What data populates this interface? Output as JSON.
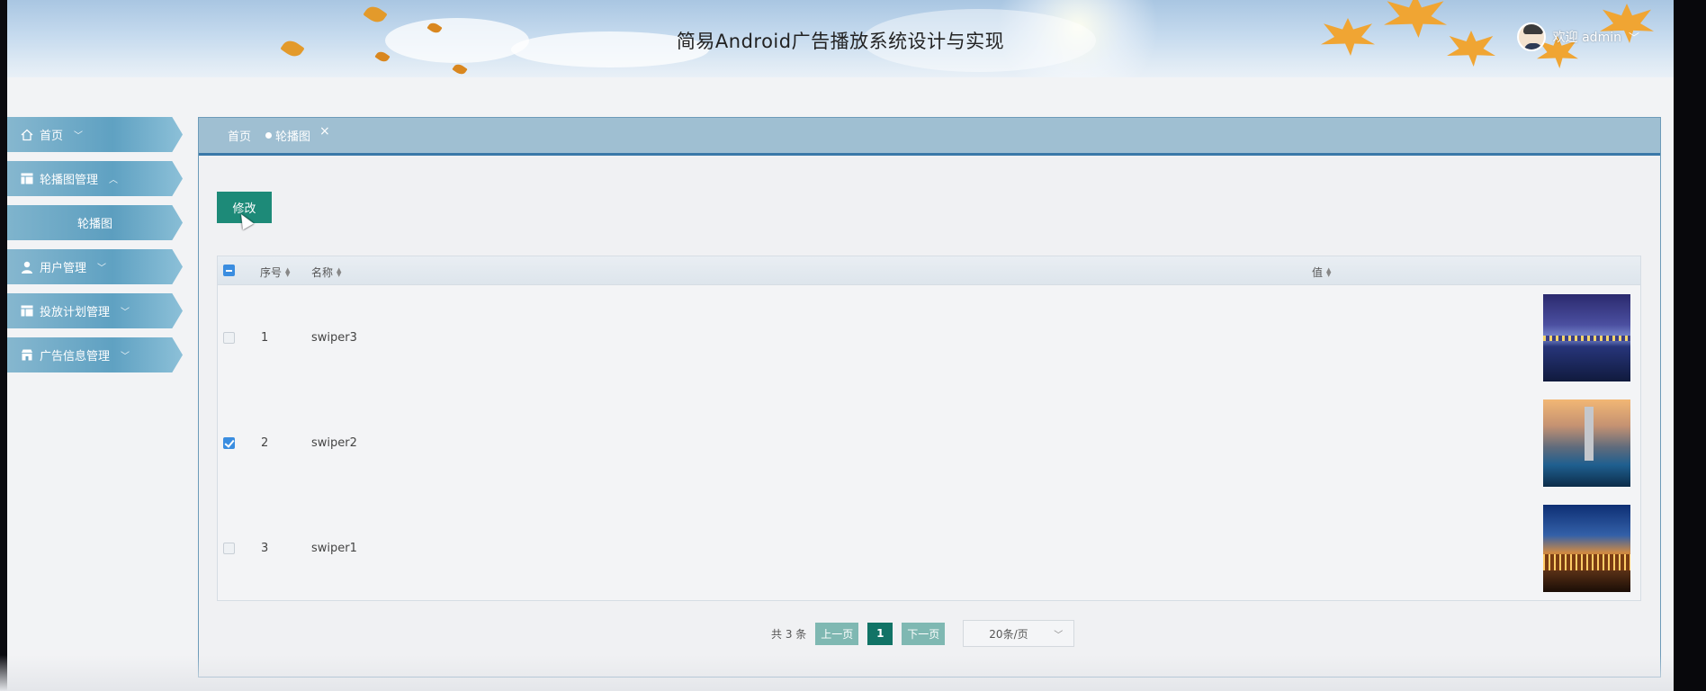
{
  "app": {
    "title": "简易Android广告播放系统设计与实现",
    "welcome": "欢迎 admin"
  },
  "sidebar": {
    "items": [
      {
        "label": "首页",
        "icon": "home-icon"
      },
      {
        "label": "轮播图管理",
        "icon": "table-icon"
      },
      {
        "label": "轮播图",
        "icon": ""
      },
      {
        "label": "用户管理",
        "icon": "user-icon"
      },
      {
        "label": "投放计划管理",
        "icon": "table-icon"
      },
      {
        "label": "广告信息管理",
        "icon": "shop-icon"
      }
    ]
  },
  "tabs": {
    "home": "首页",
    "current": "轮播图",
    "close": "×"
  },
  "toolbar": {
    "edit_label": "修改"
  },
  "table": {
    "columns": [
      "序号",
      "名称",
      "值"
    ],
    "rows": [
      {
        "index": "1",
        "name": "swiper3",
        "checked": false
      },
      {
        "index": "2",
        "name": "swiper2",
        "checked": true
      },
      {
        "index": "3",
        "name": "swiper1",
        "checked": false
      }
    ]
  },
  "pagination": {
    "total": "共 3 条",
    "prev": "上一页",
    "page": "1",
    "next": "下一页",
    "page_size": "20条/页"
  },
  "colors": {
    "accent": "#1d8a78",
    "sidebar": "#5fa1c2",
    "checkbox": "#3a8de0"
  }
}
